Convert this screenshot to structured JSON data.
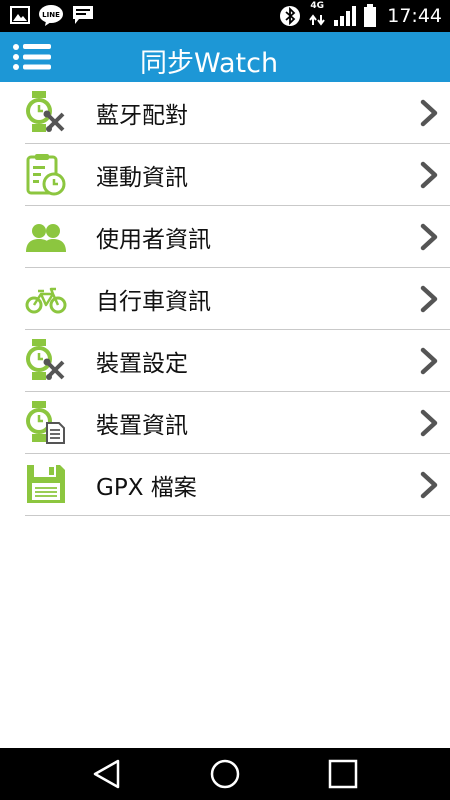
{
  "status_bar": {
    "network_type": "4G",
    "time": "17:44",
    "line_label": "LINE",
    "icons": [
      "gallery-icon",
      "line-app-icon",
      "message-icon",
      "bluetooth-icon",
      "signal-icon",
      "battery-icon"
    ]
  },
  "app_bar": {
    "title": "同步Watch",
    "menu_icon": "hamburger-menu-icon",
    "color": "#1d97d6"
  },
  "menu": {
    "items": [
      {
        "label": "藍牙配對",
        "icon": "watch-tools-icon"
      },
      {
        "label": "運動資訊",
        "icon": "clipboard-stopwatch-icon"
      },
      {
        "label": "使用者資訊",
        "icon": "users-icon"
      },
      {
        "label": "自行車資訊",
        "icon": "bicycle-icon"
      },
      {
        "label": "裝置設定",
        "icon": "watch-tools-icon"
      },
      {
        "label": "裝置資訊",
        "icon": "watch-document-icon"
      },
      {
        "label": "GPX 檔案",
        "icon": "floppy-disk-icon"
      }
    ],
    "chevron_icon": "chevron-right-icon",
    "icon_color": "#8cc63f"
  },
  "nav_bar": {
    "buttons": [
      "back-icon",
      "home-icon",
      "recent-apps-icon"
    ]
  }
}
